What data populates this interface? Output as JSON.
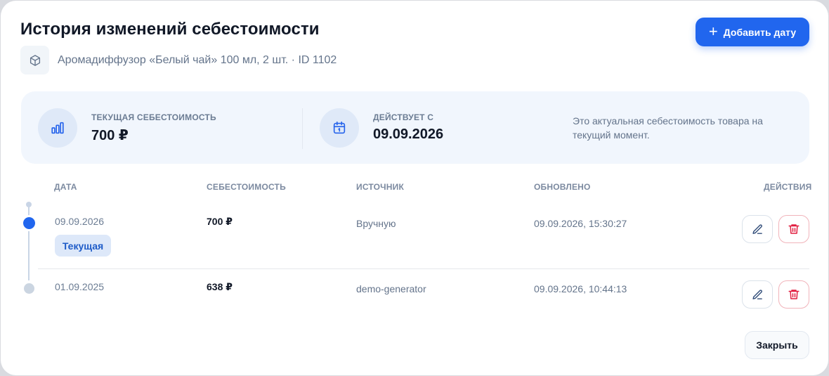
{
  "header": {
    "title": "История изменений себестоимости",
    "add_button_label": "Добавить дату",
    "product": "Аромадиффузор «Белый чай» 100 мл, 2 шт. · ID 1102"
  },
  "summary": {
    "current_label": "Текущая себестоимость",
    "current_value": "700 ₽",
    "effective_label": "Действует с",
    "effective_value": "09.09.2026",
    "note": "Это актуальная себестоимость товара на текущий момент."
  },
  "table": {
    "columns": [
      "Дата",
      "Себестоимость",
      "Источник",
      "Обновлено",
      "Действия"
    ],
    "rows": [
      {
        "date": "09.09.2026",
        "badge": "Текущая",
        "cost": "700 ₽",
        "source": "Вручную",
        "updated": "09.09.2026, 15:30:27"
      },
      {
        "date": "01.09.2025",
        "cost": "638 ₽",
        "source": "demo-generator",
        "updated": "09.09.2026, 10:44:13"
      }
    ]
  },
  "footer": {
    "close_label": "Закрыть"
  },
  "colors": {
    "accent": "#2166ee",
    "danger": "#e11d3f",
    "badge_bg": "#dde8f9",
    "summary_bg": "#f1f6fd"
  },
  "icons": [
    "plus-icon",
    "box-icon",
    "bar-chart-icon",
    "calendar-icon",
    "edit-icon",
    "trash-icon"
  ]
}
